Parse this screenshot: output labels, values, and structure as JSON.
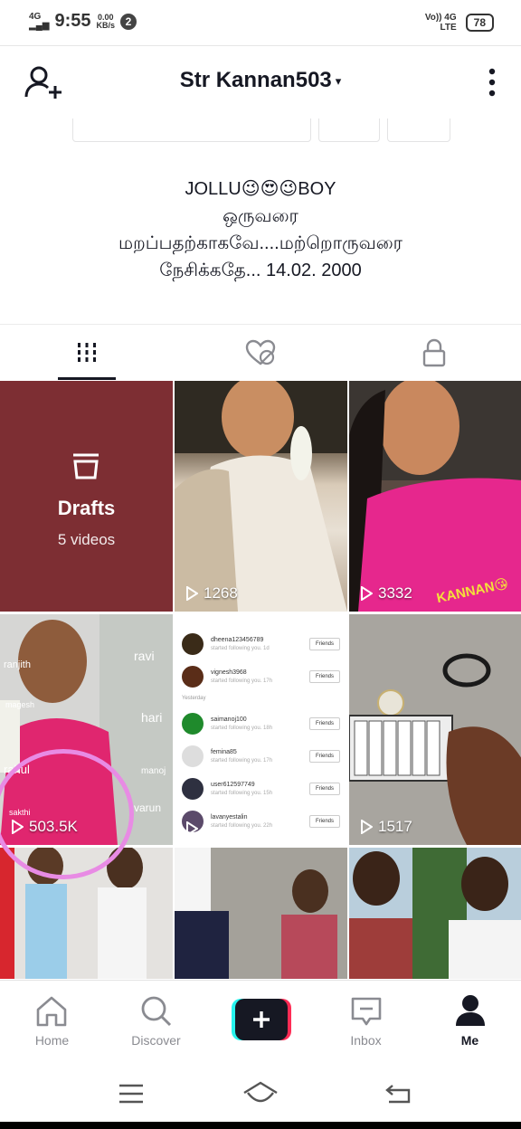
{
  "status_bar": {
    "network": "4G",
    "time": "9:55",
    "speed_value": "0.00",
    "speed_unit": "KB/s",
    "notif_count": "2",
    "volte": "Vo)) 4G",
    "lte": "LTE",
    "battery": "78"
  },
  "header": {
    "username": "Str Kannan503",
    "caret": "▾"
  },
  "bio": {
    "line1": "JOLLU😉😍😉BOY",
    "line2": "ஒருவரை",
    "line3": "மறப்பதற்காகவே....மற்றொருவரை",
    "line4": "நேசிக்கதே... 14.02. 2000"
  },
  "drafts": {
    "title": "Drafts",
    "subtitle": "5 videos"
  },
  "videos": [
    {
      "views": "1268"
    },
    {
      "views": "3332"
    },
    {
      "views": "503.5K"
    },
    {
      "views": ""
    },
    {
      "views": "1517"
    }
  ],
  "overlay_text": {
    "kannan_sticker": "KANNAN😘",
    "tags": [
      "ranjith",
      "ravi",
      "magesh",
      "hari",
      "rahul",
      "manoj",
      "sakthi",
      "varun"
    ]
  },
  "friends_list": {
    "section_label": "Yesterday",
    "button_label": "Friends",
    "rows": [
      {
        "name": "dheena123456789",
        "sub": "started following you. 1d"
      },
      {
        "name": "vignesh3968",
        "sub": "started following you. 17h"
      },
      {
        "name": "saimanoj100",
        "sub": "started following you. 18h"
      },
      {
        "name": "femina85",
        "sub": "started following you. 17h"
      },
      {
        "name": "user612597749",
        "sub": "started following you. 15h"
      },
      {
        "name": "lavanyestalin",
        "sub": "started following you. 22h"
      }
    ]
  },
  "bottom_nav": [
    {
      "label": "Home",
      "icon": "home-icon"
    },
    {
      "label": "Discover",
      "icon": "search-icon"
    },
    {
      "label": "",
      "icon": "plus-icon"
    },
    {
      "label": "Inbox",
      "icon": "inbox-icon"
    },
    {
      "label": "Me",
      "icon": "person-icon"
    }
  ],
  "colors": {
    "drafts_bg": "#7d2e33",
    "highlight_circle": "#e88be4",
    "accent_cyan": "#25f4ee",
    "accent_red": "#fe2c55"
  }
}
